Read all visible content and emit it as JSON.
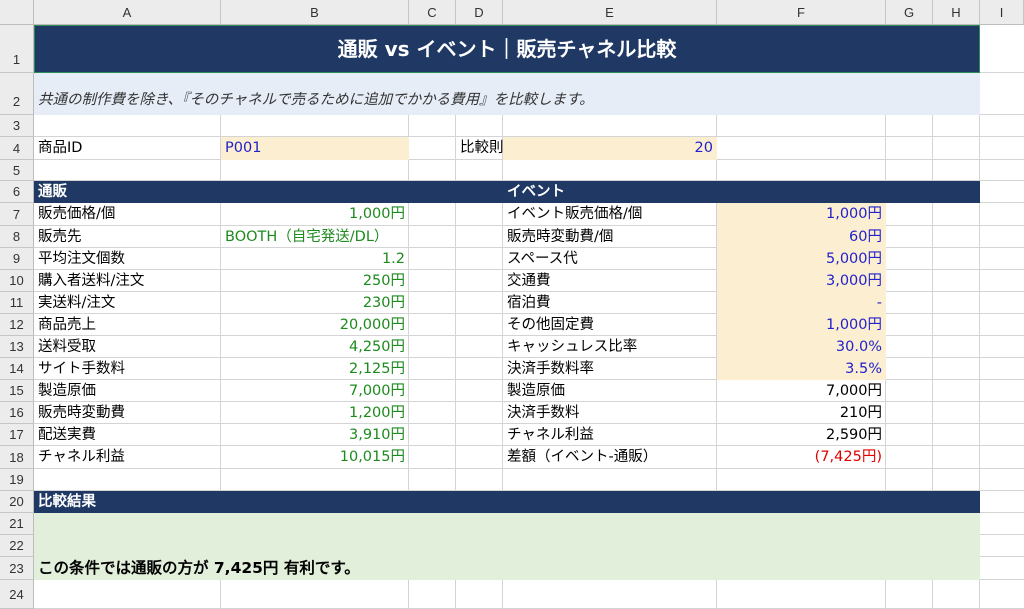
{
  "columns": [
    "A",
    "B",
    "C",
    "D",
    "E",
    "F",
    "G",
    "H",
    "I"
  ],
  "rows": [
    "1",
    "2",
    "3",
    "4",
    "5",
    "6",
    "7",
    "8",
    "9",
    "10",
    "11",
    "12",
    "13",
    "14",
    "15",
    "16",
    "17",
    "18",
    "19",
    "20",
    "21",
    "22",
    "23",
    "24"
  ],
  "title": "通販 vs イベント｜販売チャネル比較",
  "subtitle": "共通の制作費を除き、『そのチャネルで売るために追加でかかる費用』を比較します。",
  "product_id_label": "商品ID",
  "product_id_value": "P001",
  "compare_label": "比較則",
  "compare_value": "20",
  "mail_header": "通販",
  "event_header": "イベント",
  "mail_rows": [
    {
      "label": "販売価格/個",
      "value": "1,000円"
    },
    {
      "label": "販売先",
      "value": "BOOTH（自宅発送/DL）"
    },
    {
      "label": "平均注文個数",
      "value": "1.2"
    },
    {
      "label": "購入者送料/注文",
      "value": "250円"
    },
    {
      "label": "実送料/注文",
      "value": "230円"
    },
    {
      "label": "商品売上",
      "value": "20,000円"
    },
    {
      "label": "送料受取",
      "value": "4,250円"
    },
    {
      "label": "サイト手数料",
      "value": "2,125円"
    },
    {
      "label": "製造原価",
      "value": "7,000円"
    },
    {
      "label": "販売時変動費",
      "value": "1,200円"
    },
    {
      "label": "配送実費",
      "value": "3,910円"
    },
    {
      "label": "チャネル利益",
      "value": "10,015円"
    }
  ],
  "event_rows": [
    {
      "label": "イベント販売価格/個",
      "value": "1,000円"
    },
    {
      "label": "販売時変動費/個",
      "value": "60円"
    },
    {
      "label": "スペース代",
      "value": "5,000円"
    },
    {
      "label": "交通費",
      "value": "3,000円"
    },
    {
      "label": "宿泊費",
      "value": "-"
    },
    {
      "label": "その他固定費",
      "value": "1,000円"
    },
    {
      "label": "キャッシュレス比率",
      "value": "30.0%"
    },
    {
      "label": "決済手数料率",
      "value": "3.5%"
    },
    {
      "label": "製造原価",
      "value": "7,000円"
    },
    {
      "label": "決済手数料",
      "value": "210円"
    },
    {
      "label": "チャネル利益",
      "value": "2,590円"
    },
    {
      "label": "差額（イベント-通販）",
      "value": "(7,425円)"
    }
  ],
  "result_header": "比較結果",
  "result_text": "この条件では通販の方が 7,425円 有利です。",
  "colors": {
    "navy": "#1f3864",
    "light_blue": "#e6edf7",
    "input_fill": "#fcefd1",
    "result_fill": "#e2efda",
    "green_text": "#1d8a1d",
    "blue_text": "#2222cc",
    "red_text": "#e00000"
  }
}
